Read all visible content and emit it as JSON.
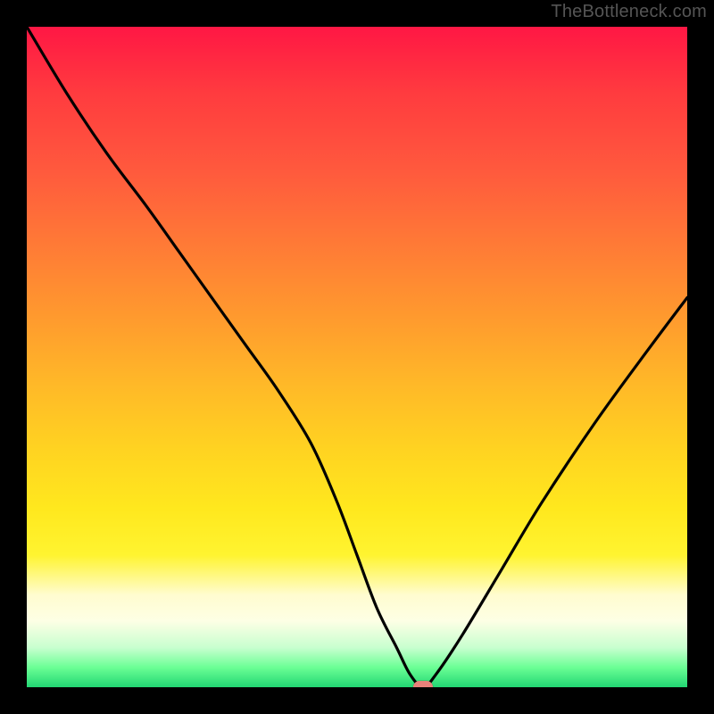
{
  "watermark": "TheBottleneck.com",
  "chart_data": {
    "type": "line",
    "title": "",
    "xlabel": "",
    "ylabel": "",
    "xlim": [
      0,
      100
    ],
    "ylim": [
      0,
      100
    ],
    "background_gradient": {
      "top": "#ff1744",
      "middle": "#ffd321",
      "bottom": "#22d673"
    },
    "series": [
      {
        "name": "bottleneck-curve",
        "x": [
          0,
          6,
          12,
          18,
          23,
          28,
          33,
          38,
          43,
          47,
          50,
          53,
          56,
          58,
          60,
          62,
          66,
          72,
          78,
          86,
          94,
          100
        ],
        "values": [
          100,
          90,
          81,
          73,
          66,
          59,
          52,
          45,
          37,
          28,
          20,
          12,
          6,
          2,
          0,
          2,
          8,
          18,
          28,
          40,
          51,
          59
        ]
      }
    ],
    "marker": {
      "x": 60,
      "y": 0,
      "color": "#e8817a"
    },
    "grid": false,
    "legend": false
  }
}
